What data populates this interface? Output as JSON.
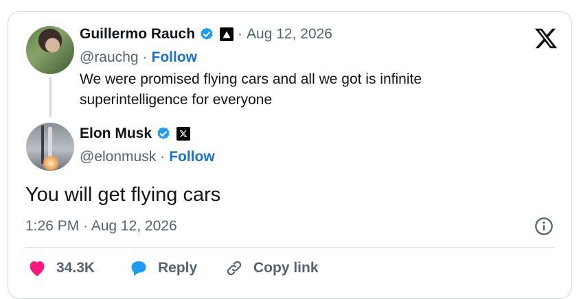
{
  "parent_post": {
    "author_name": "Guillermo Rauch",
    "date": "Aug 12, 2026",
    "handle": "@rauchg",
    "follow_label": "Follow",
    "text": "We were promised flying cars and all we got is infinite superintelligence for everyone",
    "affiliate_badge": "triangle-logo-icon"
  },
  "reply_post": {
    "author_name": "Elon Musk",
    "handle": "@elonmusk",
    "follow_label": "Follow",
    "text": "You will get flying cars",
    "timestamp": "1:26 PM · Aug 12, 2026",
    "affiliate_badge": "x-logo-icon"
  },
  "separator": "·",
  "actions": {
    "likes_count": "34.3K",
    "reply_label": "Reply",
    "copy_link_label": "Copy link"
  },
  "colors": {
    "verified": "#1d9bf0",
    "like": "#f91880",
    "reply": "#1d9bf0",
    "follow": "#1a73c8"
  }
}
